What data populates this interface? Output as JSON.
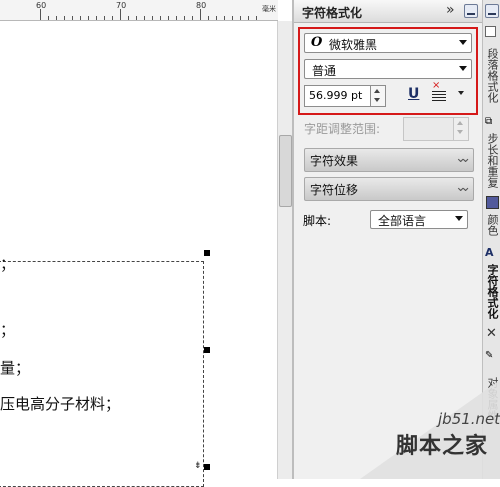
{
  "ruler": {
    "labels": [
      "60",
      "70",
      "80"
    ],
    "unit": "毫米"
  },
  "document": {
    "lines": [
      "；",
      "；",
      "量；",
      "压电高分子材料；"
    ]
  },
  "panel": {
    "title": "字符格式化",
    "font_name": "微软雅黑",
    "font_style": "普通",
    "font_size": "56.999 pt",
    "underline_glyph": "U",
    "kerning_label": "字距调整范围:",
    "kerning_value": "",
    "sections": [
      {
        "label": "字符效果"
      },
      {
        "label": "字符位移"
      }
    ],
    "script_label": "脚本:",
    "script_value": "全部语言"
  },
  "tabs": [
    "段落格式化",
    "步长和重复",
    "颜色",
    "字符格式化",
    "对象属性"
  ],
  "watermark": {
    "url": "jb51.net",
    "text": "脚本之家"
  },
  "colors": {
    "highlight_border": "#d51919",
    "swatch": "#525a9c"
  }
}
